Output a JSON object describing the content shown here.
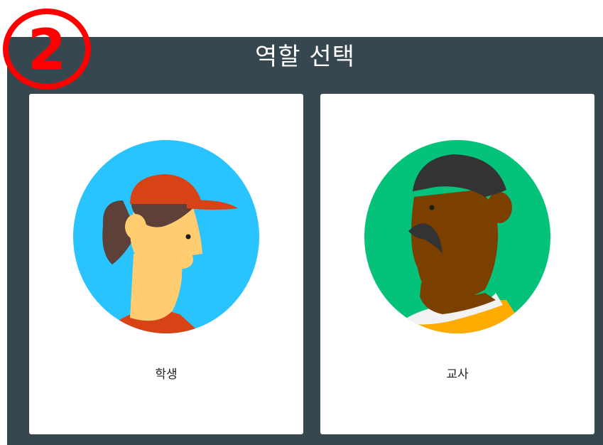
{
  "header": {
    "title": "역할 선택"
  },
  "step_badge": {
    "number": "2",
    "color": "#ff0000"
  },
  "roles": [
    {
      "label": "학생",
      "avatar_icon": "student-avatar-icon",
      "circle_color": "#29c4ff"
    },
    {
      "label": "교사",
      "avatar_icon": "teacher-avatar-icon",
      "circle_color": "#05c27a"
    }
  ],
  "colors": {
    "panel": "#37474f",
    "card": "#ffffff"
  }
}
